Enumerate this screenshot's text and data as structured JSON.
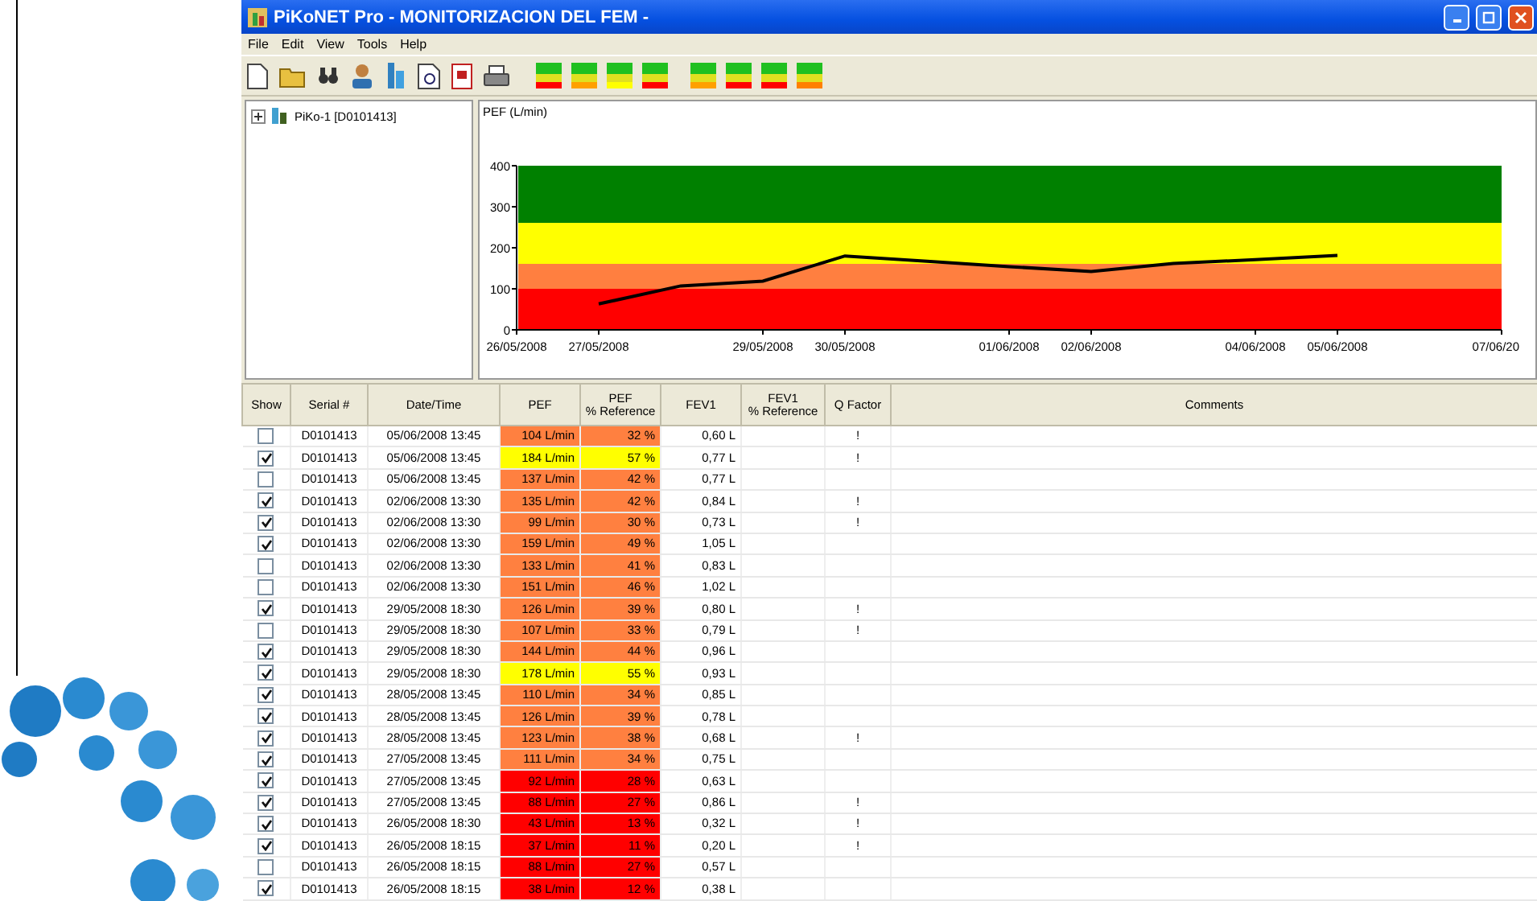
{
  "window": {
    "title": "PiKoNET Pro - MONITORIZACION DEL FEM -"
  },
  "menu": [
    "File",
    "Edit",
    "View",
    "Tools",
    "Help"
  ],
  "tree": {
    "label": "PiKo-1 [D0101413]",
    "expanded": false
  },
  "chart": {
    "chart_data": {
      "type": "line",
      "ylabel": "PEF (L/min)",
      "ylim": [
        0,
        400
      ],
      "yticks": [
        0,
        100,
        200,
        300,
        400
      ],
      "categories": [
        "26/05/2008",
        "27/05/2008",
        null,
        "29/05/2008",
        "30/05/2008",
        null,
        "01/06/2008",
        "02/06/2008",
        null,
        "04/06/2008",
        "05/06/2008",
        null,
        "07/06/20"
      ],
      "series": [
        {
          "color": "#000000",
          "values": [
            null,
            63,
            107,
            119,
            180,
            167,
            154,
            142,
            162,
            171,
            181,
            null,
            null
          ]
        }
      ]
    }
  },
  "table": {
    "columns": [
      "Show",
      "Serial #",
      "Date/Time",
      "PEF",
      "PEF\n% Reference",
      "FEV1",
      "FEV1\n% Reference",
      "Q Factor",
      "Comments"
    ],
    "rows": [
      {
        "show": false,
        "serial": "D0101413",
        "datetime": "05/06/2008 13:45",
        "pef": "104 L/min",
        "pef_ref": "32 %",
        "fev1": "0,60 L",
        "q": "!",
        "color": "#ff8040"
      },
      {
        "show": true,
        "serial": "D0101413",
        "datetime": "05/06/2008 13:45",
        "pef": "184 L/min",
        "pef_ref": "57 %",
        "fev1": "0,77 L",
        "q": "!",
        "color": "#ffff00"
      },
      {
        "show": false,
        "serial": "D0101413",
        "datetime": "05/06/2008 13:45",
        "pef": "137 L/min",
        "pef_ref": "42 %",
        "fev1": "0,77 L",
        "color": "#ff8040"
      },
      {
        "show": true,
        "serial": "D0101413",
        "datetime": "02/06/2008 13:30",
        "pef": "135 L/min",
        "pef_ref": "42 %",
        "fev1": "0,84 L",
        "q": "!",
        "color": "#ff8040"
      },
      {
        "show": true,
        "serial": "D0101413",
        "datetime": "02/06/2008 13:30",
        "pef": "99 L/min",
        "pef_ref": "30 %",
        "fev1": "0,73 L",
        "q": "!",
        "color": "#ff8040"
      },
      {
        "show": true,
        "serial": "D0101413",
        "datetime": "02/06/2008 13:30",
        "pef": "159 L/min",
        "pef_ref": "49 %",
        "fev1": "1,05 L",
        "color": "#ff8040"
      },
      {
        "show": false,
        "serial": "D0101413",
        "datetime": "02/06/2008 13:30",
        "pef": "133 L/min",
        "pef_ref": "41 %",
        "fev1": "0,83 L",
        "color": "#ff8040"
      },
      {
        "show": false,
        "serial": "D0101413",
        "datetime": "02/06/2008 13:30",
        "pef": "151 L/min",
        "pef_ref": "46 %",
        "fev1": "1,02 L",
        "color": "#ff8040"
      },
      {
        "show": true,
        "serial": "D0101413",
        "datetime": "29/05/2008 18:30",
        "pef": "126 L/min",
        "pef_ref": "39 %",
        "fev1": "0,80 L",
        "q": "!",
        "color": "#ff8040"
      },
      {
        "show": false,
        "serial": "D0101413",
        "datetime": "29/05/2008 18:30",
        "pef": "107 L/min",
        "pef_ref": "33 %",
        "fev1": "0,79 L",
        "q": "!",
        "color": "#ff8040"
      },
      {
        "show": true,
        "serial": "D0101413",
        "datetime": "29/05/2008 18:30",
        "pef": "144 L/min",
        "pef_ref": "44 %",
        "fev1": "0,96 L",
        "color": "#ff8040"
      },
      {
        "show": true,
        "serial": "D0101413",
        "datetime": "29/05/2008 18:30",
        "pef": "178 L/min",
        "pef_ref": "55 %",
        "fev1": "0,93 L",
        "color": "#ffff00"
      },
      {
        "show": true,
        "serial": "D0101413",
        "datetime": "28/05/2008 13:45",
        "pef": "110 L/min",
        "pef_ref": "34 %",
        "fev1": "0,85 L",
        "color": "#ff8040"
      },
      {
        "show": true,
        "serial": "D0101413",
        "datetime": "28/05/2008 13:45",
        "pef": "126 L/min",
        "pef_ref": "39 %",
        "fev1": "0,78 L",
        "color": "#ff8040"
      },
      {
        "show": true,
        "serial": "D0101413",
        "datetime": "28/05/2008 13:45",
        "pef": "123 L/min",
        "pef_ref": "38 %",
        "fev1": "0,68 L",
        "q": "!",
        "color": "#ff8040"
      },
      {
        "show": true,
        "serial": "D0101413",
        "datetime": "27/05/2008 13:45",
        "pef": "111 L/min",
        "pef_ref": "34 %",
        "fev1": "0,75 L",
        "color": "#ff8040"
      },
      {
        "show": true,
        "serial": "D0101413",
        "datetime": "27/05/2008 13:45",
        "pef": "92 L/min",
        "pef_ref": "28 %",
        "fev1": "0,63 L",
        "color": "#ff0000"
      },
      {
        "show": true,
        "serial": "D0101413",
        "datetime": "27/05/2008 13:45",
        "pef": "88 L/min",
        "pef_ref": "27 %",
        "fev1": "0,86 L",
        "q": "!",
        "color": "#ff0000"
      },
      {
        "show": true,
        "serial": "D0101413",
        "datetime": "26/05/2008 18:30",
        "pef": "43 L/min",
        "pef_ref": "13 %",
        "fev1": "0,32 L",
        "q": "!",
        "color": "#ff0000"
      },
      {
        "show": true,
        "serial": "D0101413",
        "datetime": "26/05/2008 18:15",
        "pef": "37 L/min",
        "pef_ref": "11 %",
        "fev1": "0,20 L",
        "q": "!",
        "color": "#ff0000"
      },
      {
        "show": false,
        "serial": "D0101413",
        "datetime": "26/05/2008 18:15",
        "pef": "88 L/min",
        "pef_ref": "27 %",
        "fev1": "0,57 L",
        "color": "#ff0000"
      },
      {
        "show": true,
        "serial": "D0101413",
        "datetime": "26/05/2008 18:15",
        "pef": "38 L/min",
        "pef_ref": "12 %",
        "fev1": "0,38 L",
        "color": "#ff0000"
      }
    ]
  }
}
